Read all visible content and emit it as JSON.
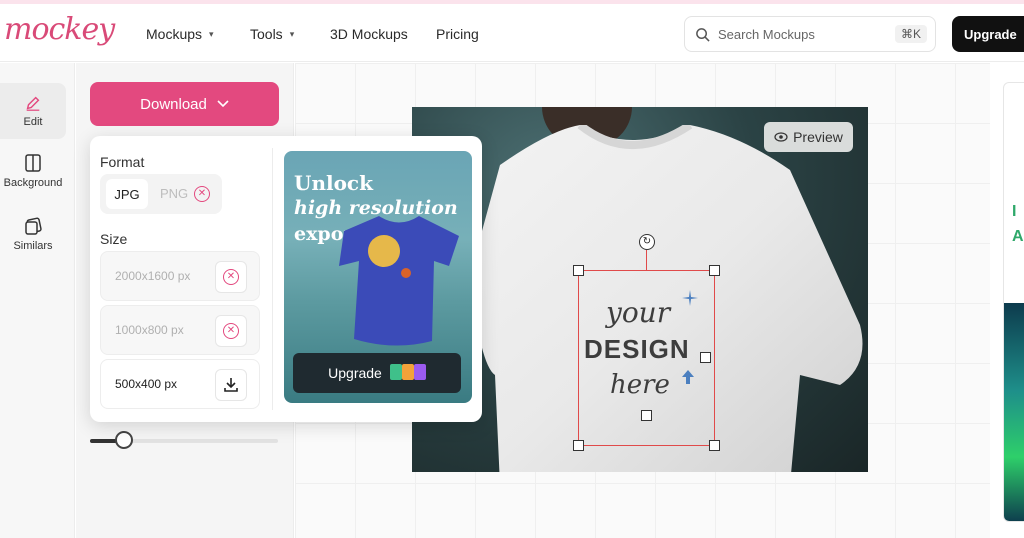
{
  "brand": {
    "logo": "mockey",
    "accent": "#e3497f"
  },
  "nav": [
    {
      "label": "Mockups",
      "has_dropdown": true
    },
    {
      "label": "Tools",
      "has_dropdown": true
    },
    {
      "label": "3D Mockups",
      "has_dropdown": false
    },
    {
      "label": "Pricing",
      "has_dropdown": false
    }
  ],
  "search": {
    "placeholder": "Search Mockups",
    "shortcut": "⌘K"
  },
  "header_upgrade": "Upgrade",
  "sidebar": {
    "items": [
      {
        "label": "Edit",
        "icon": "pencil-icon",
        "active": true
      },
      {
        "label": "Background",
        "icon": "background-icon",
        "active": false
      },
      {
        "label": "Similars",
        "icon": "similars-icon",
        "active": false
      }
    ]
  },
  "download": {
    "button_label": "Download",
    "format_label": "Format",
    "formats": [
      {
        "label": "JPG",
        "selected": true
      },
      {
        "label": "PNG",
        "locked": true
      }
    ],
    "size_label": "Size",
    "sizes": [
      {
        "label": "2000x1600 px",
        "available": false
      },
      {
        "label": "1000x800 px",
        "available": false
      },
      {
        "label": "500x400 px",
        "available": true
      }
    ],
    "promo": {
      "line1": "Unlock",
      "line2": "high resolution",
      "line3": "export",
      "button": "Upgrade"
    }
  },
  "canvas": {
    "preview_label": "Preview",
    "design_lines": [
      "your",
      "DESIGN",
      "here"
    ]
  },
  "slider": {
    "value": 0.18
  }
}
